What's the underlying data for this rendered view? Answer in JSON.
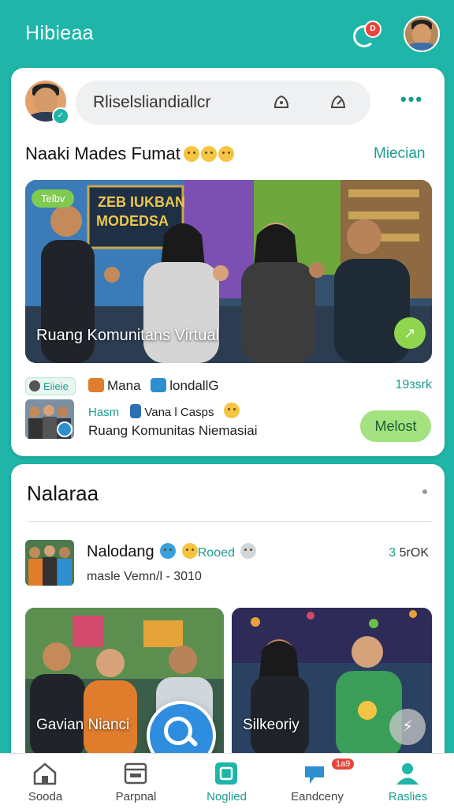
{
  "header": {
    "app_title": "Hibieaa",
    "notif_badge": "D"
  },
  "composer": {
    "placeholder": "Rliselsliandiallcr",
    "more": "•••"
  },
  "post": {
    "title": "Naaki Mades Fumat",
    "link": "Miecian",
    "hero_tag": "Telbv",
    "hero_caption": "Ruang Komunitans Virtual",
    "hero_go": "↗",
    "chip_label": "Eiieie",
    "meta_a1": "Mana",
    "meta_a2": "londallG",
    "count": "19зsrk",
    "meta_green": "Hasm",
    "meta_vana": "Vana l Casps",
    "group_name": "Ruang Komunitas Niemasiai",
    "follow_label": "Melost"
  },
  "feed": {
    "title": "Nalaraa",
    "item": {
      "title": "Nalodang",
      "tag": "Rooed",
      "subtitle": "masle Vemn/l - 3010",
      "count_a": "3",
      "count_b": "5rOK"
    },
    "tiles": [
      {
        "label": "Gavian Nianci"
      },
      {
        "label": "Silkeoriy",
        "go": "⚡"
      }
    ]
  },
  "nav": {
    "items": [
      {
        "label": "Sooda",
        "icon": "home-icon"
      },
      {
        "label": "Parpnal",
        "icon": "calendar-icon"
      },
      {
        "label": "Noglied",
        "icon": "square-icon"
      },
      {
        "label": "Eandceny",
        "icon": "chat-icon",
        "badge": "1a9"
      },
      {
        "label": "Raslies",
        "icon": "profile-icon"
      }
    ]
  },
  "colors": {
    "brand": "#1fb5a8",
    "accent_green": "#a3e27e",
    "link": "#1a9d8f",
    "fab": "#2f8de0"
  }
}
